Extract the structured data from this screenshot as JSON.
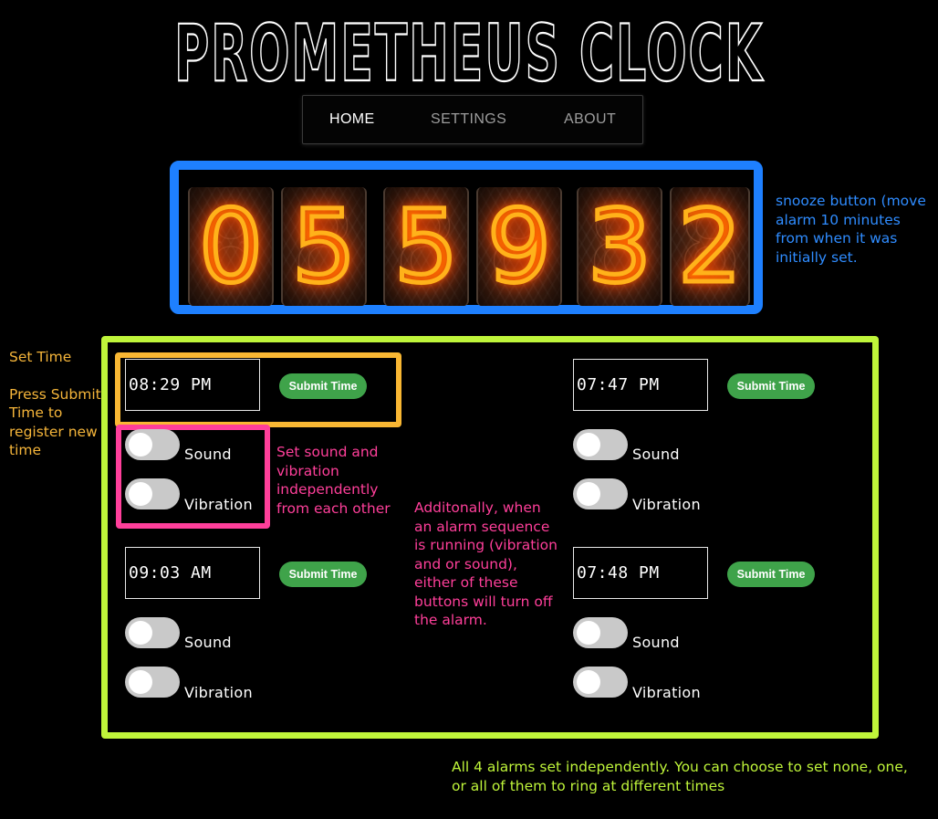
{
  "app": {
    "title": "PROMETHEUS CLOCK"
  },
  "nav": {
    "items": [
      {
        "label": "HOME",
        "active": true
      },
      {
        "label": "SETTINGS",
        "active": false
      },
      {
        "label": "ABOUT",
        "active": false
      }
    ]
  },
  "clock": {
    "digits": [
      "0",
      "5",
      "5",
      "9",
      "3",
      "2"
    ]
  },
  "alarms": [
    {
      "time": "08:29 PM",
      "submit_label": "Submit Time",
      "sound_label": "Sound",
      "vibration_label": "Vibration",
      "sound_on": false,
      "vibration_on": false
    },
    {
      "time": "07:47 PM",
      "submit_label": "Submit Time",
      "sound_label": "Sound",
      "vibration_label": "Vibration",
      "sound_on": false,
      "vibration_on": false
    },
    {
      "time": "09:03 AM",
      "submit_label": "Submit Time",
      "sound_label": "Sound",
      "vibration_label": "Vibration",
      "sound_on": false,
      "vibration_on": false
    },
    {
      "time": "07:48 PM",
      "submit_label": "Submit Time",
      "sound_label": "Sound",
      "vibration_label": "Vibration",
      "sound_on": false,
      "vibration_on": false
    }
  ],
  "annotations": {
    "snooze": "snooze button (move alarm 10 minutes  from when it was initially set.",
    "set_time_title": "Set Time",
    "set_time_body": "Press Submit Time to register new time",
    "sound_vibration": "Set sound and vibration independently from each other",
    "additionally": "Additonally, when an alarm sequence is running (vibration and or sound), either of these buttons will turn off the alarm.",
    "all_alarms": "All 4 alarms set independently. You can choose to set none, one, or all of them to ring at different times"
  },
  "colors": {
    "snooze_frame": "#1e80ff",
    "alarms_frame": "#bff53a",
    "set_time_frame": "#f9b733",
    "toggles_frame": "#ff3f9a",
    "submit_button": "#3fa34a",
    "nixie_glow": "#ff6a00"
  }
}
